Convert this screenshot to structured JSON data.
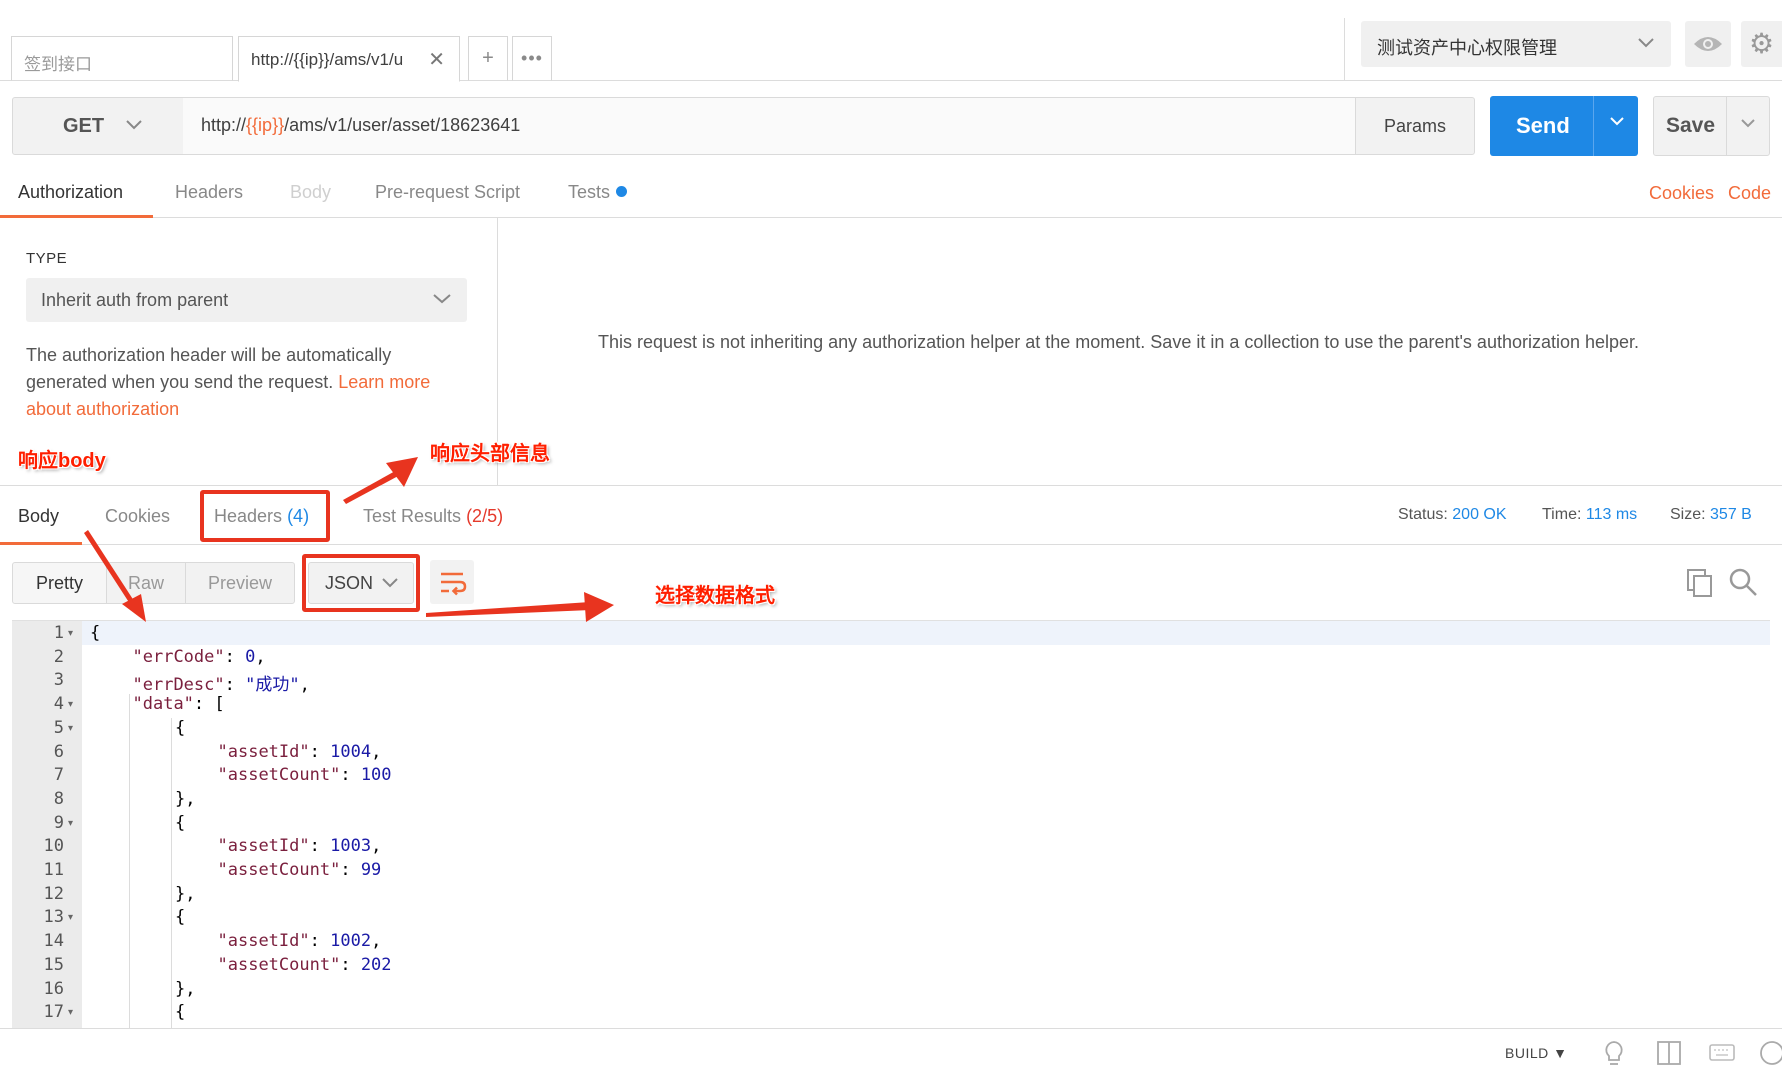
{
  "tabs": [
    {
      "label": "签到接口"
    },
    {
      "label": "http://{{ip}}/ams/v1/u",
      "close": "✕"
    }
  ],
  "tab_actions": {
    "new_tab": "+",
    "more": "•••"
  },
  "environment": {
    "selected": "测试资产中心权限管理"
  },
  "request": {
    "method": "GET",
    "url_prefix": "http://",
    "url_variable": "{{ip}}",
    "url_suffix": "/ams/v1/user/asset/18623641",
    "params_label": "Params",
    "send_label": "Send",
    "save_label": "Save"
  },
  "request_tabs": [
    {
      "label": "Authorization",
      "state": "active"
    },
    {
      "label": "Headers",
      "state": "normal"
    },
    {
      "label": "Body",
      "state": "disabled"
    },
    {
      "label": "Pre-request Script",
      "state": "normal"
    },
    {
      "label": "Tests",
      "state": "normal",
      "indicator": "blue-dot"
    }
  ],
  "request_links": {
    "cookies": "Cookies",
    "code": "Code"
  },
  "auth": {
    "type_label": "TYPE",
    "type_value": "Inherit auth from parent",
    "description": "The authorization header will be automatically generated when you send the request. ",
    "learn_more": "Learn more about authorization",
    "message": "This request is not inheriting any authorization helper at the moment. Save it in a collection to use the parent's authorization helper."
  },
  "response_tabs": {
    "body": "Body",
    "cookies": "Cookies",
    "headers": "Headers",
    "headers_count": "(4)",
    "tests": "Test Results",
    "tests_count": "(2/5)"
  },
  "response_meta": {
    "status_label": "Status:",
    "status_value": "200 OK",
    "time_label": "Time:",
    "time_value": "113 ms",
    "size_label": "Size:",
    "size_value": "357 B"
  },
  "body_views": {
    "pretty": "Pretty",
    "raw": "Raw",
    "preview": "Preview",
    "format": "JSON"
  },
  "code_lines": [
    {
      "n": "1",
      "fold": true
    },
    {
      "n": "2",
      "key": "\"errCode\"",
      "value": "0",
      "trail": ","
    },
    {
      "n": "3",
      "key": "\"errDesc\"",
      "value": "\"成功\"",
      "trail": ","
    },
    {
      "n": "4",
      "fold": true,
      "key": "\"data\"",
      "value": "[",
      "trail": ""
    },
    {
      "n": "5",
      "fold": true,
      "text": "{"
    },
    {
      "n": "6",
      "key": "\"assetId\"",
      "value": "1004",
      "trail": ","
    },
    {
      "n": "7",
      "key": "\"assetCount\"",
      "value": "100",
      "trail": ""
    },
    {
      "n": "8",
      "text": "},"
    },
    {
      "n": "9",
      "fold": true,
      "text": "{"
    },
    {
      "n": "10",
      "key": "\"assetId\"",
      "value": "1003",
      "trail": ","
    },
    {
      "n": "11",
      "key": "\"assetCount\"",
      "value": "99",
      "trail": ""
    },
    {
      "n": "12",
      "text": "},"
    },
    {
      "n": "13",
      "fold": true,
      "text": "{"
    },
    {
      "n": "14",
      "key": "\"assetId\"",
      "value": "1002",
      "trail": ","
    },
    {
      "n": "15",
      "key": "\"assetCount\"",
      "value": "202",
      "trail": ""
    },
    {
      "n": "16",
      "text": "},"
    },
    {
      "n": "17",
      "fold": true,
      "text": "{"
    }
  ],
  "code_root_open": "{",
  "statusbar": {
    "build": "BUILD ▼"
  },
  "annotations": {
    "body": "响应body",
    "headers": "响应头部信息",
    "format": "选择数据格式"
  },
  "colors": {
    "accent": "#f26b3a",
    "send": "#1e88e5",
    "annotation": "#ff1f00"
  },
  "icons": [
    "close-icon",
    "plus-icon",
    "more-icon",
    "chevron-down-icon",
    "eye-icon",
    "gear-icon",
    "wrap-lines-icon",
    "copy-icon",
    "search-icon",
    "lightbulb-icon",
    "two-pane-icon",
    "keyboard-icon",
    "help-icon"
  ]
}
